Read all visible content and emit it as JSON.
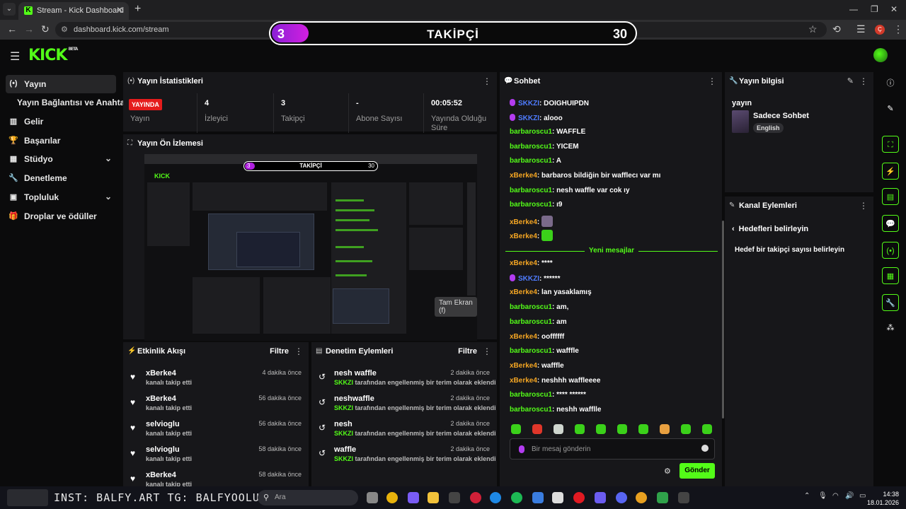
{
  "browser": {
    "tab_title": "Stream - Kick Dashboard",
    "url": "dashboard.kick.com/stream"
  },
  "goal_overlay": {
    "current": "3",
    "title": "TAKİPÇİ",
    "target": "30",
    "progress_fraction": 0.1
  },
  "brand": {
    "logo": "KICK",
    "beta": "BETA",
    "accent": "#53fc18"
  },
  "sidebar": {
    "items": [
      {
        "label": "Yayın",
        "icon": "broadcast-icon"
      },
      {
        "label": "Yayın Bağlantısı ve Anahtarı",
        "icon": ""
      },
      {
        "label": "Gelir",
        "icon": "chart-icon"
      },
      {
        "label": "Başarılar",
        "icon": "trophy-icon"
      },
      {
        "label": "Stüdyo",
        "icon": "studio-icon"
      },
      {
        "label": "Denetleme",
        "icon": "wrench-icon"
      },
      {
        "label": "Topluluk",
        "icon": "community-icon"
      },
      {
        "label": "Droplar ve ödüller",
        "icon": "gift-icon"
      }
    ]
  },
  "stats": {
    "title": "Yayın İstatistikleri",
    "live_badge": "YAYINDA",
    "live_label": "Yayın",
    "viewers_value": "4",
    "viewers_label": "İzleyici",
    "followers_value": "3",
    "followers_label": "Takipçi",
    "subs_value": "-",
    "subs_label": "Abone Sayısı",
    "uptime_value": "00:05:52",
    "uptime_label": "Yayında Olduğu Süre"
  },
  "preview": {
    "title": "Yayın Ön İzlemesi",
    "fullscreen_tip": "Tam Ekran (f)",
    "inner_goal_current": "3",
    "inner_goal_title": "TAKİPÇİ",
    "inner_goal_target": "30",
    "inner_logo": "KICK"
  },
  "activity": {
    "title": "Etkinlik Akışı",
    "filter": "Filtre",
    "items": [
      {
        "name": "xBerke4",
        "desc": "kanalı takip etti",
        "time": "4 dakika önce"
      },
      {
        "name": "xBerke4",
        "desc": "kanalı takip etti",
        "time": "56 dakika önce"
      },
      {
        "name": "selvioglu",
        "desc": "kanalı takip etti",
        "time": "56 dakika önce"
      },
      {
        "name": "selvioglu",
        "desc": "kanalı takip etti",
        "time": "58 dakika önce"
      },
      {
        "name": "xBerke4",
        "desc": "kanalı takip etti",
        "time": "58 dakika önce"
      }
    ]
  },
  "moderation": {
    "title": "Denetim Eylemleri",
    "filter": "Filtre",
    "items": [
      {
        "name": "nesh waffle",
        "actor": "SKKZI",
        "desc": "tarafından engellenmiş bir terim olarak eklendi",
        "time": "2 dakika önce"
      },
      {
        "name": "neshwaffle",
        "actor": "SKKZI",
        "desc": "tarafından engellenmiş bir terim olarak eklendi",
        "time": "2 dakika önce"
      },
      {
        "name": "nesh",
        "actor": "SKKZI",
        "desc": "tarafından engellenmiş bir terim olarak eklendi",
        "time": "2 dakika önce"
      },
      {
        "name": "waffle",
        "actor": "SKKZI",
        "desc": "tarafından engellenmiş bir terim olarak eklendi",
        "time": "2 dakika önce"
      }
    ]
  },
  "chat": {
    "title": "Sohbet",
    "new_messages": "Yeni mesajlar",
    "input_placeholder": "Bir mesaj gönderin",
    "send": "Gönder",
    "messages_before": [
      {
        "user": "SKKZI",
        "text": "DOIGHUIPDN",
        "color": "blue",
        "mic": true
      },
      {
        "user": "SKKZI",
        "text": "alooo",
        "color": "blue",
        "mic": true
      },
      {
        "user": "barbaroscu1",
        "text": "WAFFLE",
        "color": "green"
      },
      {
        "user": "barbaroscu1",
        "text": "YICEM",
        "color": "green"
      },
      {
        "user": "barbaroscu1",
        "text": "A",
        "color": "green"
      },
      {
        "user": "xBerke4",
        "text": "barbaros bildiğin bir wafflecı var mı",
        "color": "orange"
      },
      {
        "user": "barbaroscu1",
        "text": "nesh waffle var cok ıy",
        "color": "green"
      },
      {
        "user": "barbaroscu1",
        "text": "ı9",
        "color": "green"
      },
      {
        "user": "xBerke4",
        "text": "",
        "color": "orange",
        "emote": "#7a6a8a"
      },
      {
        "user": "xBerke4",
        "text": "",
        "color": "orange",
        "emote": "#3bd11a"
      }
    ],
    "messages_after": [
      {
        "user": "xBerke4",
        "text": "****",
        "color": "orange"
      },
      {
        "user": "SKKZI",
        "text": "******",
        "color": "blue",
        "mic": true
      },
      {
        "user": "xBerke4",
        "text": "lan yasaklamış",
        "color": "orange"
      },
      {
        "user": "barbaroscu1",
        "text": "am,",
        "color": "green"
      },
      {
        "user": "barbaroscu1",
        "text": "am",
        "color": "green"
      },
      {
        "user": "xBerke4",
        "text": "ooffffff",
        "color": "orange"
      },
      {
        "user": "barbaroscu1",
        "text": "wafffle",
        "color": "green"
      },
      {
        "user": "xBerke4",
        "text": "wafffle",
        "color": "orange"
      },
      {
        "user": "xBerke4",
        "text": "neshhh waffleeee",
        "color": "orange"
      },
      {
        "user": "barbaroscu1",
        "text": "**** ******",
        "color": "green"
      },
      {
        "user": "barbaroscu1",
        "text": "neshh wafflle",
        "color": "green"
      }
    ]
  },
  "stream_info": {
    "title": "Yayın bilgisi",
    "stream_title": "yayın",
    "category": "Sadece Sohbet",
    "language": "English"
  },
  "channel_actions": {
    "title": "Kanal Eylemleri",
    "back_title": "Hedefleri belirleyin",
    "option": "Hedef bir takipçi sayısı belirleyin"
  },
  "taskbar": {
    "overlay_text": "INST: BALFY.ART TG: BALFYOOLUR",
    "search_placeholder": "Ara",
    "time": "14:38",
    "date": "18.01.2026"
  }
}
